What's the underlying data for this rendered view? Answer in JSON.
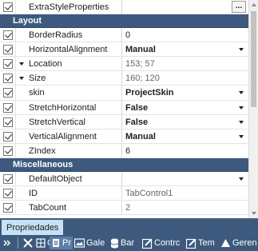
{
  "rows_top": {
    "extra": {
      "name": "ExtraStyleProperties",
      "ellipsis": "..."
    }
  },
  "layout": {
    "header": "Layout",
    "border_radius": {
      "name": "BorderRadius",
      "value": "0"
    },
    "h_align": {
      "name": "HorizontalAlignment",
      "value": "Manual"
    },
    "location": {
      "name": "Location",
      "value": "153; 57"
    },
    "size": {
      "name": "Size",
      "value": "160; 120"
    },
    "skin": {
      "name": "skin",
      "value": "ProjectSkin"
    },
    "stretch_h": {
      "name": "StretchHorizontal",
      "value": "False"
    },
    "stretch_v": {
      "name": "StretchVertical",
      "value": "False"
    },
    "v_align": {
      "name": "VerticalAlignment",
      "value": "Manual"
    },
    "zindex": {
      "name": "ZIndex",
      "value": "6"
    }
  },
  "misc": {
    "header": "Miscellaneous",
    "default_object": {
      "name": "DefaultObject",
      "value": ""
    },
    "id": {
      "name": "ID",
      "value": "TabControl1"
    },
    "tab_count": {
      "name": "TabCount",
      "value": "2"
    }
  },
  "tabs": {
    "active": "Propriedades"
  },
  "toolbar": {
    "items": [
      {
        "label": "",
        "icon": "close-icon"
      },
      {
        "label": "C",
        "icon": "grid-icon"
      },
      {
        "label": "Pr",
        "icon": "properties-icon"
      },
      {
        "label": "Gale",
        "icon": "gallery-icon"
      },
      {
        "label": "Bar",
        "icon": "database-icon"
      },
      {
        "label": "Contrc",
        "icon": "edit-icon"
      },
      {
        "label": "Tem",
        "icon": "template-icon"
      },
      {
        "label": "Geren",
        "icon": "manager-icon"
      }
    ]
  },
  "colors": {
    "category_bg": "#3d5a7e",
    "active_tab_bg": "#c6e2f4"
  }
}
